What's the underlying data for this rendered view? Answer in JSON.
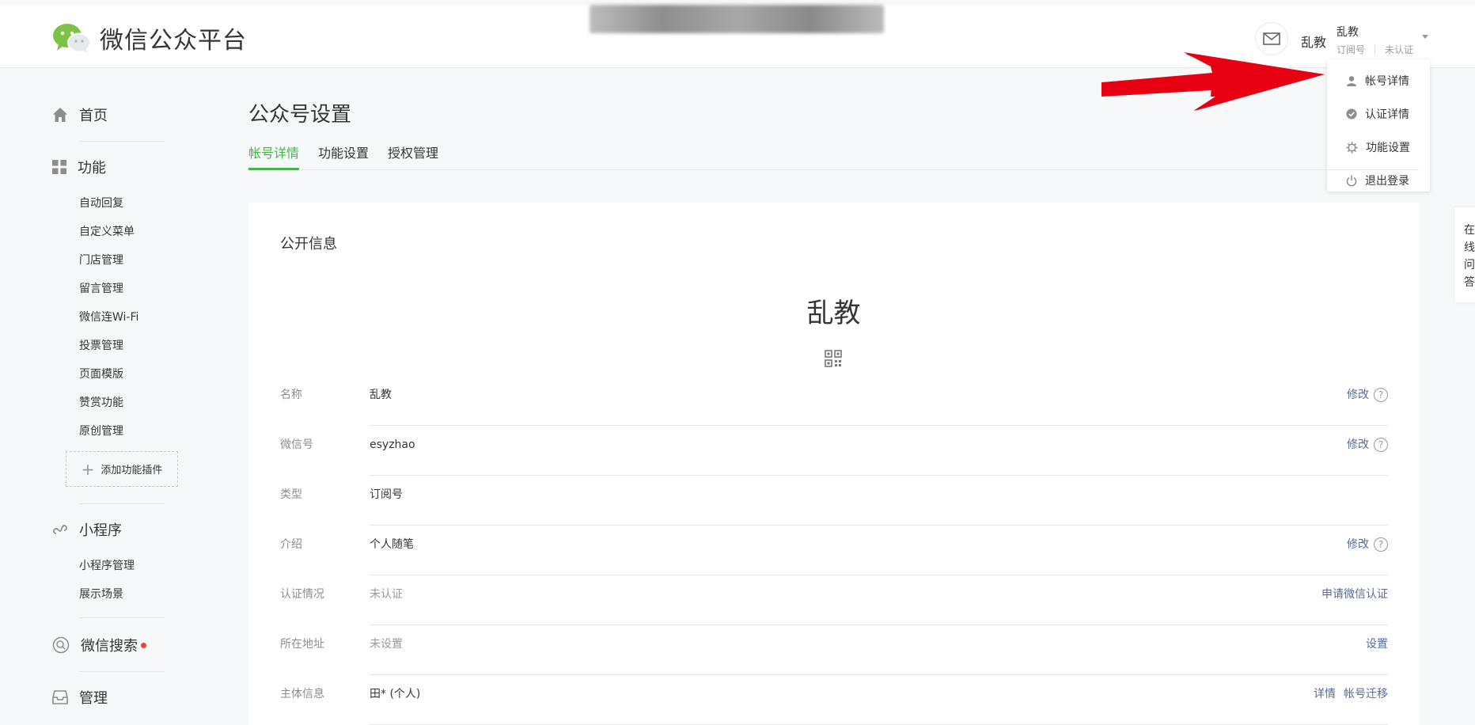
{
  "header": {
    "logo_text": "微信公众平台",
    "user_name": "乱教",
    "account": {
      "name": "乱教",
      "type": "订阅号",
      "cert_status": "未认证"
    }
  },
  "dropdown": {
    "items": [
      {
        "label": "帐号详情",
        "icon": "user-icon"
      },
      {
        "label": "认证详情",
        "icon": "verified-icon"
      },
      {
        "label": "功能设置",
        "icon": "gear-icon"
      },
      {
        "label": "退出登录",
        "icon": "power-icon"
      }
    ]
  },
  "sidebar": {
    "home": "首页",
    "features": {
      "label": "功能",
      "items": [
        "自动回复",
        "自定义菜单",
        "门店管理",
        "留言管理",
        "微信连Wi-Fi",
        "投票管理",
        "页面模版",
        "赞赏功能",
        "原创管理"
      ],
      "add_plugin": "添加功能插件"
    },
    "mini_program": {
      "label": "小程序",
      "items": [
        "小程序管理",
        "展示场景"
      ]
    },
    "wechat_search": "微信搜索",
    "manage": "管理"
  },
  "main": {
    "title": "公众号设置",
    "tabs": [
      "帐号详情",
      "功能设置",
      "授权管理"
    ],
    "section_title": "公开信息",
    "display_name": "乱教",
    "rows": [
      {
        "label": "名称",
        "value": "乱教",
        "action": "修改",
        "help": "?"
      },
      {
        "label": "微信号",
        "value": "esyzhao",
        "action": "修改",
        "help": "?"
      },
      {
        "label": "类型",
        "value": "订阅号"
      },
      {
        "label": "介绍",
        "value": "个人随笔",
        "action": "修改",
        "help": "?"
      },
      {
        "label": "认证情况",
        "value": "未认证",
        "action": "申请微信认证"
      },
      {
        "label": "所在地址",
        "value": "未设置",
        "action": "设置"
      },
      {
        "label": "主体信息",
        "value": "田* (个人)",
        "action": "详情",
        "action2": "帐号迁移"
      }
    ]
  },
  "side_float": [
    "在",
    "线",
    "问",
    "答"
  ],
  "colors": {
    "accent_green": "#44b549",
    "link_blue": "#576b95",
    "arrow_red": "#e60012"
  }
}
